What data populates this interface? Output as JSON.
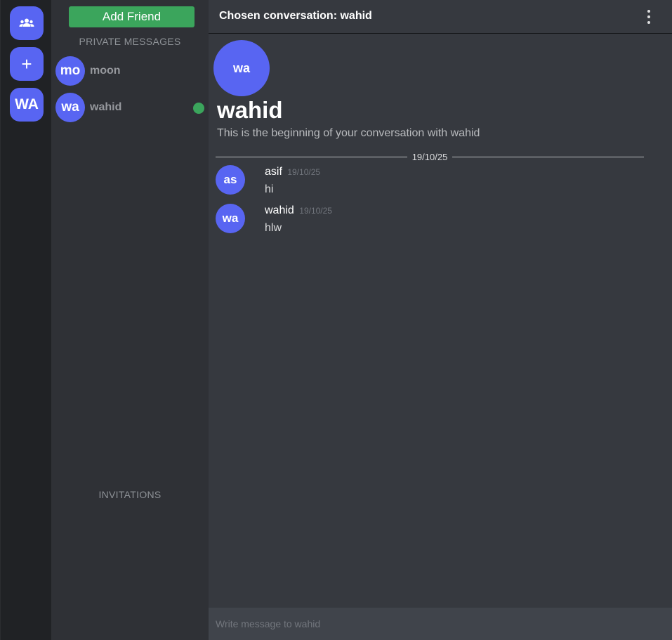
{
  "rail": {
    "friends_icon": "users-icon",
    "add_icon": "plus-icon",
    "add_glyph": "+",
    "server_initials": "WA"
  },
  "sidebar": {
    "add_friend_label": "Add Friend",
    "private_messages_title": "PRIVATE MESSAGES",
    "dms": [
      {
        "initials": "mo",
        "name": "moon",
        "online": false
      },
      {
        "initials": "wa",
        "name": "wahid",
        "online": true
      }
    ],
    "invitations_title": "INVITATIONS"
  },
  "chat": {
    "header_title": "Chosen conversation: wahid",
    "menu_icon": "vertical-ellipsis-icon",
    "hero": {
      "initials": "wa",
      "name": "wahid",
      "subtitle": "This is the beginning of your conversation with wahid"
    },
    "date_divider": "19/10/25",
    "messages": [
      {
        "initials": "as",
        "author": "asif",
        "time": "19/10/25",
        "text": "hi"
      },
      {
        "initials": "wa",
        "author": "wahid",
        "time": "19/10/25",
        "text": "hlw"
      }
    ],
    "composer_placeholder": "Write message to wahid"
  },
  "colors": {
    "accent": "#5865f2",
    "online": "#3ba55c",
    "add_friend": "#3ba55c",
    "rail_bg": "#202225",
    "sidebar_bg": "#2f3136",
    "chat_bg": "#36393f"
  }
}
